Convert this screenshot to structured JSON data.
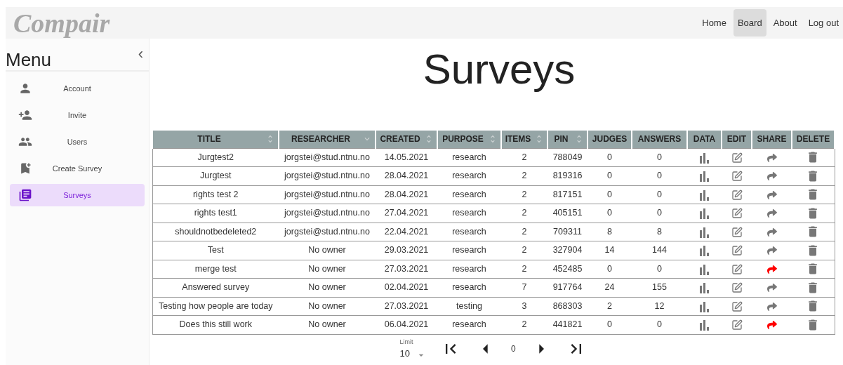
{
  "logo": "Compair",
  "nav": [
    {
      "label": "Home",
      "selected": false
    },
    {
      "label": "Board",
      "selected": true
    },
    {
      "label": "About",
      "selected": false
    },
    {
      "label": "Log out",
      "selected": false
    }
  ],
  "sidebar": {
    "title": "Menu",
    "collapse": "‹",
    "items": [
      {
        "label": "Account",
        "kind": "account",
        "selected": false
      },
      {
        "label": "Invite",
        "kind": "invite",
        "selected": false
      },
      {
        "label": "Users",
        "kind": "users",
        "selected": false
      },
      {
        "label": "Create Survey",
        "kind": "create",
        "selected": false
      },
      {
        "label": "Surveys",
        "kind": "surveys",
        "selected": true
      }
    ]
  },
  "page_title": "Surveys",
  "table": {
    "columns": [
      {
        "label": "TITLE",
        "kind": "sortable"
      },
      {
        "label": "RESEARCHER",
        "kind": "descending"
      },
      {
        "label": "CREATED",
        "kind": "sortable"
      },
      {
        "label": "PURPOSE",
        "kind": "sortable"
      },
      {
        "label": "ITEMS",
        "kind": "sortable"
      },
      {
        "label": "PIN",
        "kind": "sortable"
      },
      {
        "label": "JUDGES",
        "kind": "plain"
      },
      {
        "label": "ANSWERS",
        "kind": "plain"
      },
      {
        "label": "DATA",
        "kind": "plain"
      },
      {
        "label": "EDIT",
        "kind": "plain"
      },
      {
        "label": "SHARE",
        "kind": "plain"
      },
      {
        "label": "DELETE",
        "kind": "plain"
      }
    ],
    "rows": [
      {
        "title": "Jurgtest2",
        "researcher": "jorgstei@stud.ntnu.no",
        "created": "14.05.2021",
        "purpose": "research",
        "items": "2",
        "pin": "788049",
        "judges": "0",
        "answers": "0",
        "shared": false
      },
      {
        "title": "Jurgtest",
        "researcher": "jorgstei@stud.ntnu.no",
        "created": "28.04.2021",
        "purpose": "research",
        "items": "2",
        "pin": "819316",
        "judges": "0",
        "answers": "0",
        "shared": false
      },
      {
        "title": "rights test 2",
        "researcher": "jorgstei@stud.ntnu.no",
        "created": "28.04.2021",
        "purpose": "research",
        "items": "2",
        "pin": "817151",
        "judges": "0",
        "answers": "0",
        "shared": false
      },
      {
        "title": "rights test1",
        "researcher": "jorgstei@stud.ntnu.no",
        "created": "27.04.2021",
        "purpose": "research",
        "items": "2",
        "pin": "405151",
        "judges": "0",
        "answers": "0",
        "shared": false
      },
      {
        "title": "shouldnotbedeleted2",
        "researcher": "jorgstei@stud.ntnu.no",
        "created": "22.04.2021",
        "purpose": "research",
        "items": "2",
        "pin": "709311",
        "judges": "8",
        "answers": "8",
        "shared": false
      },
      {
        "title": "Test",
        "researcher": "No owner",
        "created": "29.03.2021",
        "purpose": "research",
        "items": "2",
        "pin": "327904",
        "judges": "14",
        "answers": "144",
        "shared": false
      },
      {
        "title": "merge test",
        "researcher": "No owner",
        "created": "27.03.2021",
        "purpose": "research",
        "items": "2",
        "pin": "452485",
        "judges": "0",
        "answers": "0",
        "shared": true
      },
      {
        "title": "Answered survey",
        "researcher": "No owner",
        "created": "02.04.2021",
        "purpose": "research",
        "items": "7",
        "pin": "917764",
        "judges": "24",
        "answers": "155",
        "shared": false
      },
      {
        "title": "Testing how people are today",
        "researcher": "No owner",
        "created": "27.03.2021",
        "purpose": "testing",
        "items": "3",
        "pin": "868303",
        "judges": "2",
        "answers": "12",
        "shared": false
      },
      {
        "title": "Does this still work",
        "researcher": "No owner",
        "created": "06.04.2021",
        "purpose": "research",
        "items": "2",
        "pin": "441821",
        "judges": "0",
        "answers": "0",
        "shared": true
      }
    ]
  },
  "pagination": {
    "limit_label": "Limit",
    "limit": "10",
    "page": "0"
  }
}
